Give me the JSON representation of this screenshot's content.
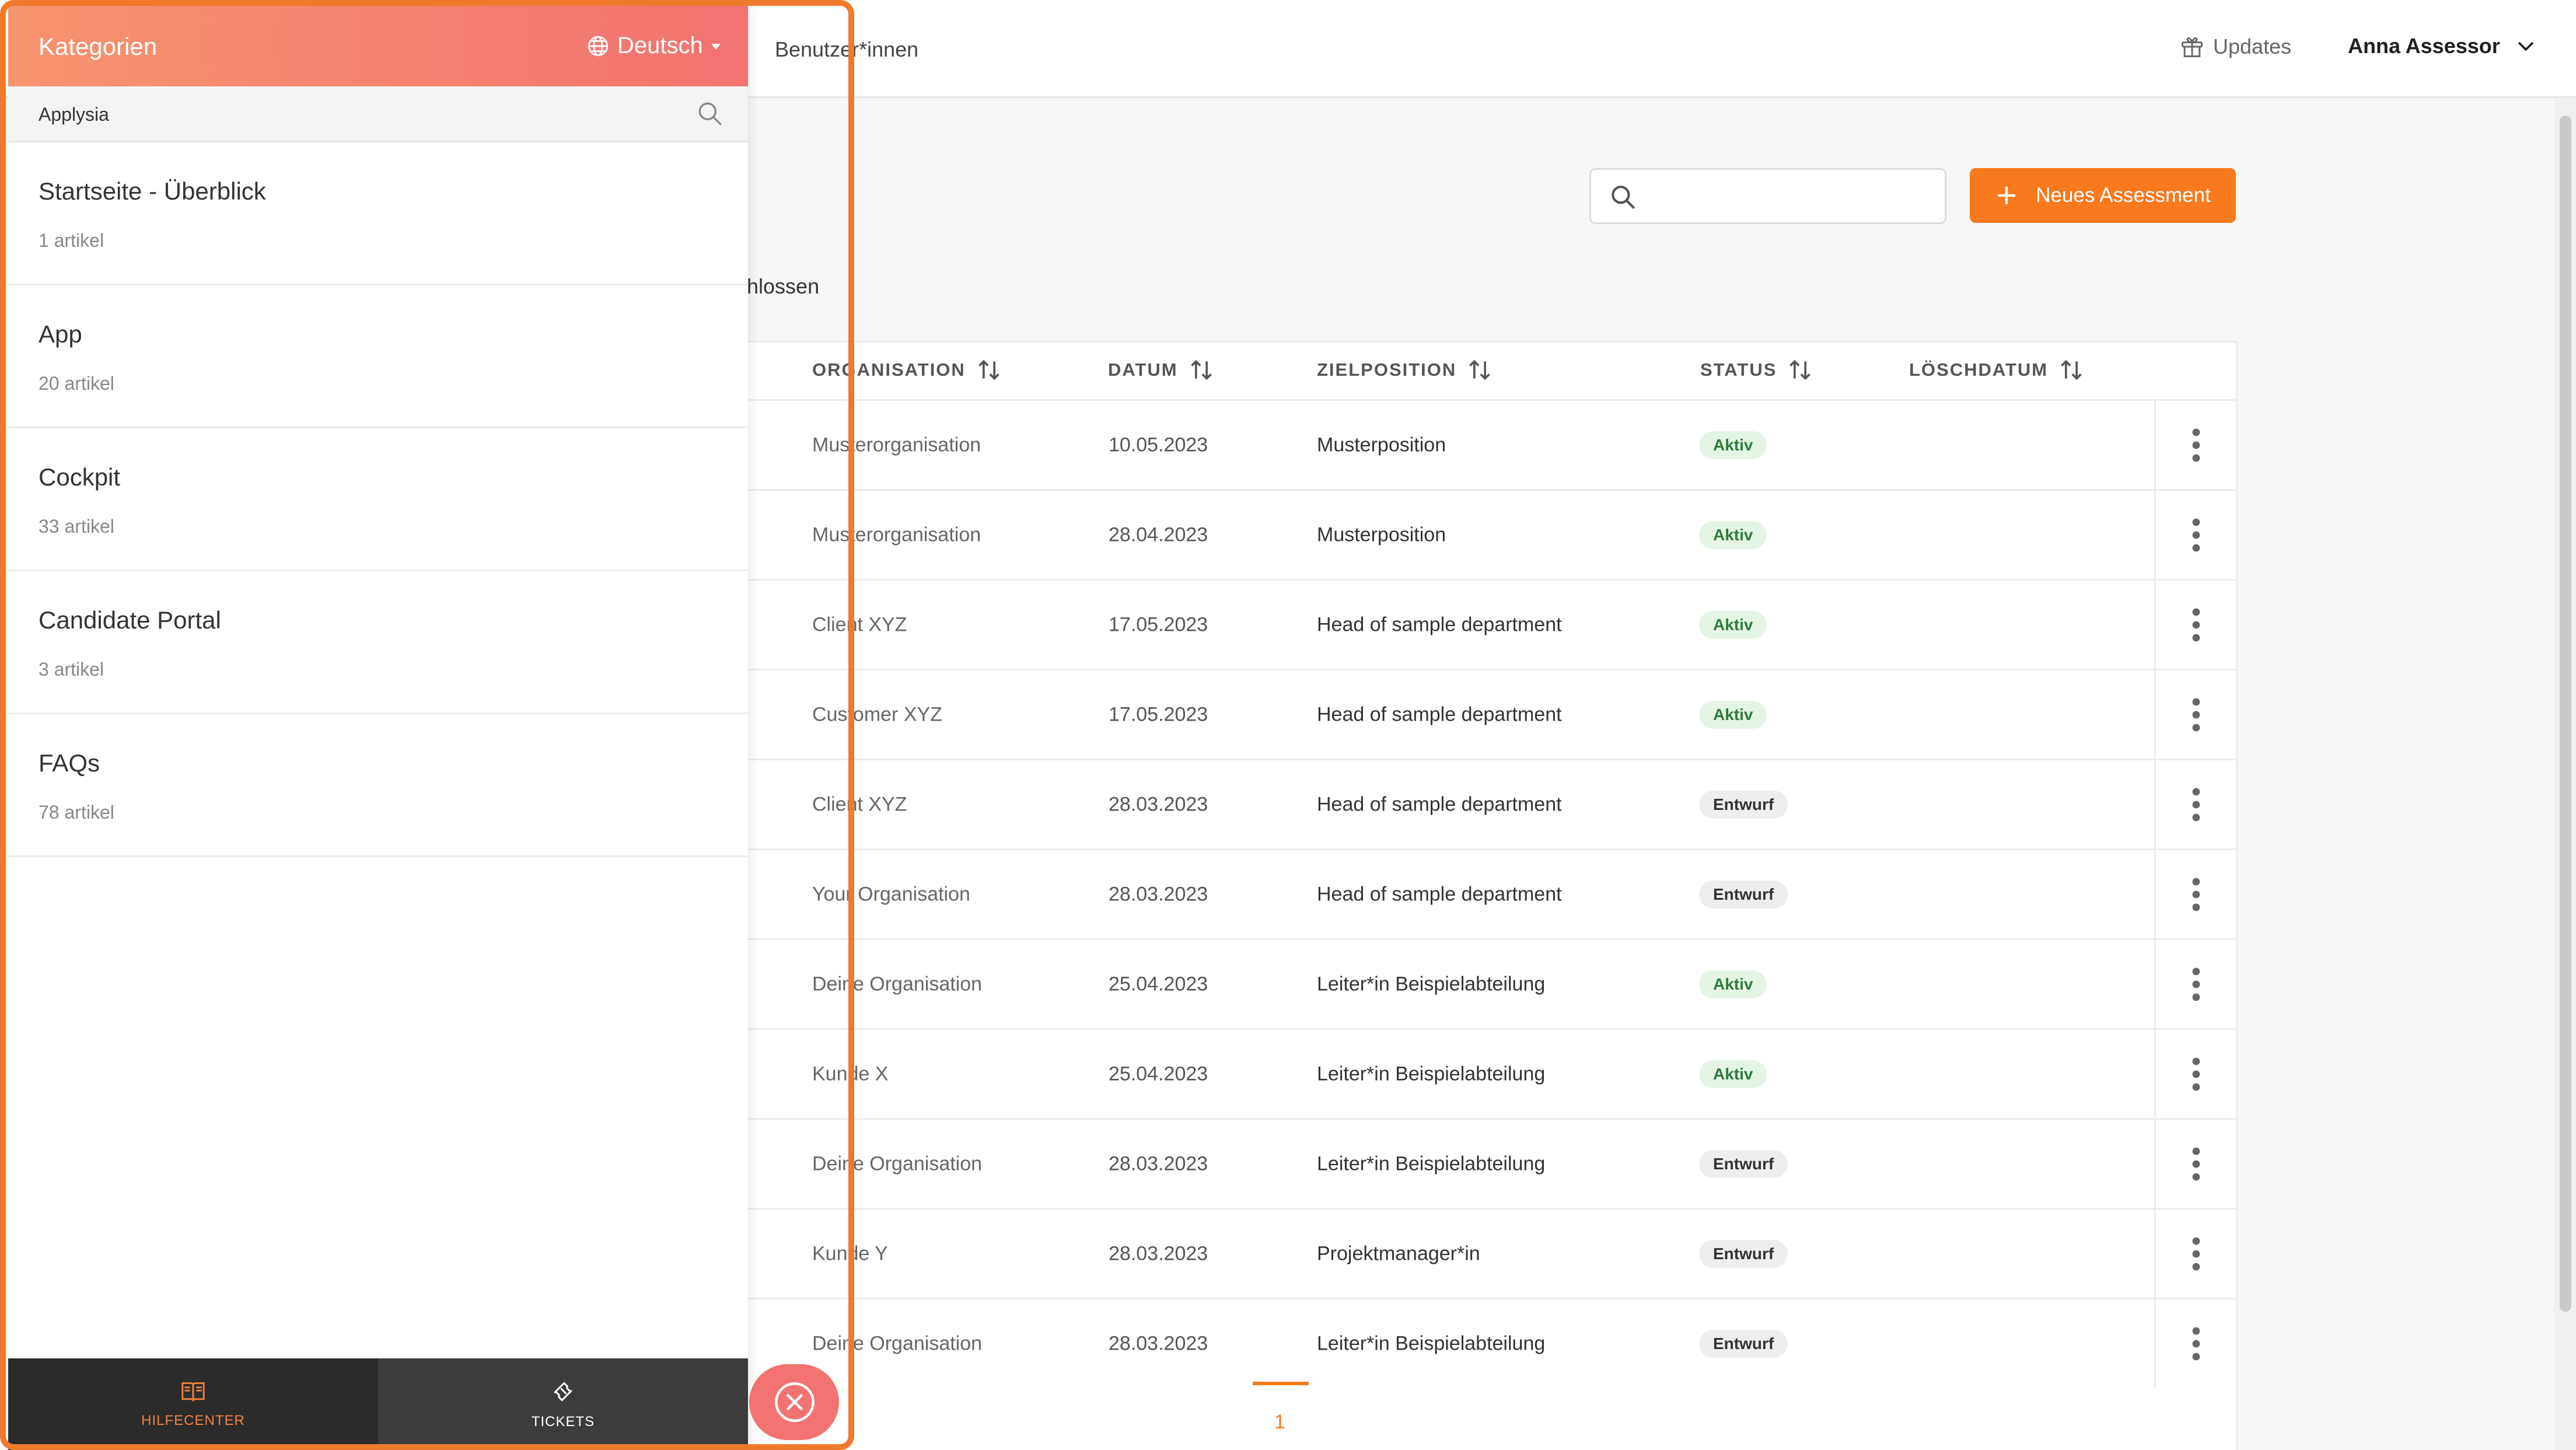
{
  "topbar": {
    "nav_users": "Benutzer*innen",
    "updates_label": "Updates",
    "user_name": "Anna Assessor"
  },
  "toolbar": {
    "search_placeholder": "",
    "new_button_label": "Neues Assessment",
    "tab_closed_partial": "hlossen"
  },
  "table": {
    "headers": {
      "organisation": "ORGANISATION",
      "datum": "DATUM",
      "zielposition": "ZIELPOSITION",
      "status": "STATUS",
      "loeschdatum": "LÖSCHDATUM"
    },
    "rows": [
      {
        "org": "Musterorganisation",
        "date": "10.05.2023",
        "position": "Musterposition",
        "status": "Aktiv",
        "status_kind": "aktiv"
      },
      {
        "org": "Musterorganisation",
        "date": "28.04.2023",
        "position": "Musterposition",
        "status": "Aktiv",
        "status_kind": "aktiv"
      },
      {
        "org": "Client XYZ",
        "date": "17.05.2023",
        "position": "Head of sample department",
        "status": "Aktiv",
        "status_kind": "aktiv"
      },
      {
        "org": "Customer XYZ",
        "date": "17.05.2023",
        "position": "Head of sample department",
        "status": "Aktiv",
        "status_kind": "aktiv"
      },
      {
        "org": "Client XYZ",
        "date": "28.03.2023",
        "position": "Head of sample department",
        "status": "Entwurf",
        "status_kind": "entwurf"
      },
      {
        "org": "Your Organisation",
        "date": "28.03.2023",
        "position": "Head of sample department",
        "status": "Entwurf",
        "status_kind": "entwurf"
      },
      {
        "org": "Deine Organisation",
        "date": "25.04.2023",
        "position": "Leiter*in Beispielabteilung",
        "status": "Aktiv",
        "status_kind": "aktiv"
      },
      {
        "org": "Kunde X",
        "date": "25.04.2023",
        "position": "Leiter*in Beispielabteilung",
        "status": "Aktiv",
        "status_kind": "aktiv"
      },
      {
        "org": "Deine Organisation",
        "date": "28.03.2023",
        "position": "Leiter*in Beispielabteilung",
        "status": "Entwurf",
        "status_kind": "entwurf"
      },
      {
        "org": "Kunde Y",
        "date": "28.03.2023",
        "position": "Projektmanager*in",
        "status": "Entwurf",
        "status_kind": "entwurf"
      },
      {
        "org": "Deine Organisation",
        "date": "28.03.2023",
        "position": "Leiter*in Beispielabteilung",
        "status": "Entwurf",
        "status_kind": "entwurf"
      }
    ]
  },
  "pagination": {
    "current": "1"
  },
  "help": {
    "title": "Kategorien",
    "language": "Deutsch",
    "search_value": "Applysia",
    "categories": [
      {
        "name": "Startseite - Überblick",
        "count": "1 artikel"
      },
      {
        "name": "App",
        "count": "20 artikel"
      },
      {
        "name": "Cockpit",
        "count": "33 artikel"
      },
      {
        "name": "Candidate Portal",
        "count": "3 artikel"
      },
      {
        "name": "FAQs",
        "count": "78 artikel"
      }
    ],
    "footer": {
      "helpcenter_label": "HILFECENTER",
      "tickets_label": "TICKETS"
    }
  },
  "colors": {
    "accent": "#f87a1d",
    "help_gradient_start": "#f6946e",
    "help_gradient_end": "#f27370",
    "badge_active_bg": "#e4f5e6",
    "badge_active_text": "#2e7d3a",
    "badge_draft_bg": "#eeeeee"
  }
}
